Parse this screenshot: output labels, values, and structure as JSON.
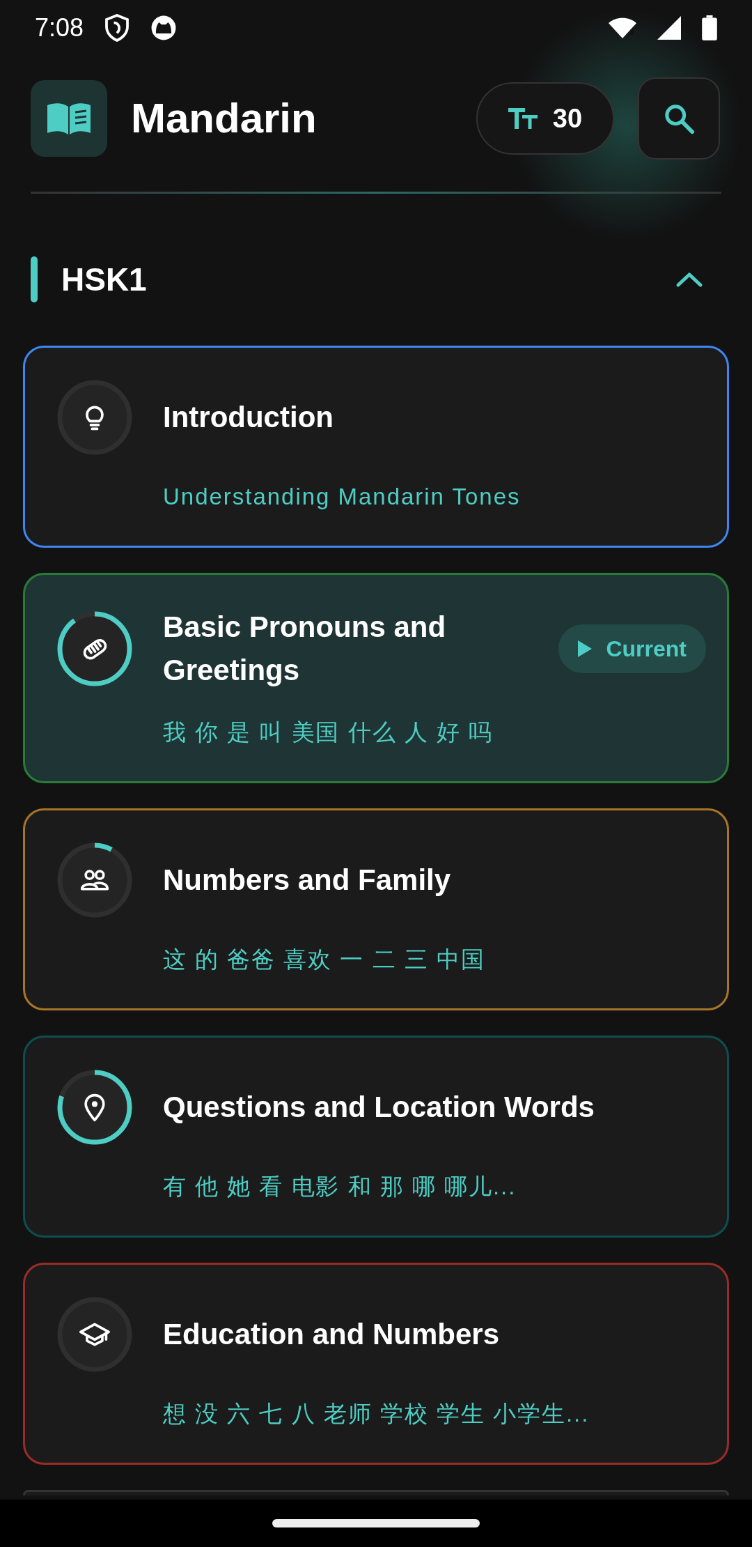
{
  "status_bar": {
    "time": "7:08"
  },
  "header": {
    "title": "Mandarin",
    "font_size": "30"
  },
  "section": {
    "title": "HSK1",
    "expanded": true
  },
  "lessons": [
    {
      "title": "Introduction",
      "subtitle": "Understanding Mandarin Tones",
      "color": "#3f86f0",
      "level": 0,
      "current": false
    },
    {
      "title": "Basic Pronouns and Greetings",
      "subtitle": "我 你 是 叫 美国 什么 人 好 吗",
      "color": "#2a7a38",
      "level": 0.9,
      "current": true,
      "badge": "Current"
    },
    {
      "title": "Numbers and Family",
      "subtitle": "这 的 爸爸 喜欢 一 二 三 中国",
      "color": "#a87428",
      "level": 0.08,
      "current": false
    },
    {
      "title": "Questions and Location Words",
      "subtitle": "有 他 她 看 电影 和 那 哪 哪儿...",
      "color": "#0e4e50",
      "level": 0.8,
      "current": false
    },
    {
      "title": "Education and Numbers",
      "subtitle": "想 没 六 七 八 老师 学校 学生 小学生...",
      "color": "#9a2c28",
      "level": 0,
      "current": false
    }
  ]
}
